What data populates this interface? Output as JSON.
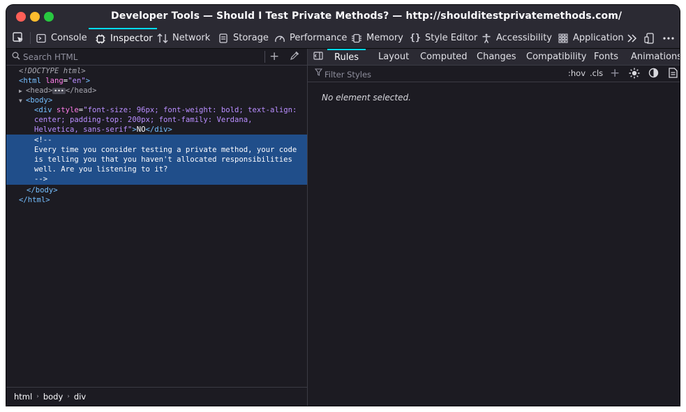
{
  "window": {
    "title": "Developer Tools — Should I Test Private Methods? — http://shoulditestprivatemethods.com/"
  },
  "toolbar": {
    "tabs": [
      {
        "label": "Console",
        "icon": "console-icon"
      },
      {
        "label": "Inspector",
        "icon": "inspector-icon",
        "active": true
      },
      {
        "label": "Network",
        "icon": "network-icon"
      },
      {
        "label": "Storage",
        "icon": "storage-icon"
      },
      {
        "label": "Performance",
        "icon": "performance-icon"
      },
      {
        "label": "Memory",
        "icon": "memory-icon"
      },
      {
        "label": "Style Editor",
        "icon": "style-editor-icon"
      },
      {
        "label": "Accessibility",
        "icon": "accessibility-icon"
      },
      {
        "label": "Application",
        "icon": "application-icon"
      }
    ]
  },
  "inspector": {
    "search_placeholder": "Search HTML",
    "markup": {
      "doctype": "<!DOCTYPE html>",
      "html_open_tag": "<html",
      "html_attr_name": "lang",
      "html_attr_value": "\"en\"",
      "html_close_bracket": ">",
      "head_open": "<head>",
      "head_close": "</head>",
      "body_open": "<body>",
      "div_open_tag": "<div",
      "div_attr_name": "style",
      "div_style_line1": "\"font-size: 96px; font-weight: bold; text-align:",
      "div_style_line2": "center; padding-top: 200px; font-family: Verdana,",
      "div_style_line3": "Helvetica, sans-serif\"",
      "div_text": "NO",
      "div_close": "</div>",
      "comment_open": "<!--",
      "comment_line1": "Every time you consider testing a private method, your code",
      "comment_line2": "is telling you that you haven't allocated responsibilities",
      "comment_line3": "well. Are you listening to it?",
      "comment_close": "-->",
      "body_close": "</body>",
      "html_close": "</html>"
    },
    "breadcrumbs": [
      "html",
      "body",
      "div"
    ]
  },
  "sidebar": {
    "tabs": [
      {
        "label": "Rules",
        "active": true
      },
      {
        "label": "Layout"
      },
      {
        "label": "Computed"
      },
      {
        "label": "Changes"
      },
      {
        "label": "Compatibility"
      },
      {
        "label": "Fonts"
      },
      {
        "label": "Animations"
      }
    ],
    "filter_placeholder": "Filter Styles",
    "hov_label": ":hov",
    "cls_label": ".cls",
    "empty_message": "No element selected."
  },
  "colors": {
    "accent": "#00ddff",
    "selection": "#204e8a",
    "tag": "#75bfff",
    "attribute": "#ff7de9",
    "attribute_value": "#b98eff"
  }
}
